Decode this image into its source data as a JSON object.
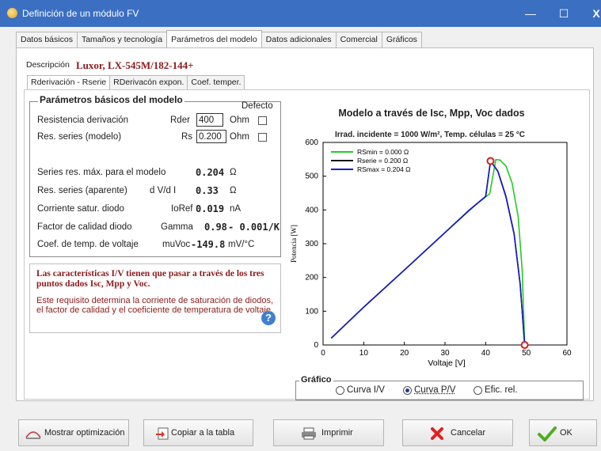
{
  "window": {
    "title": "Definición de un módulo FV",
    "minimize": "—",
    "maximize": "☐",
    "close": "X"
  },
  "tabs": [
    "Datos básicos",
    "Tamaños y tecnología",
    "Parámetros del modelo",
    "Datos adicionales",
    "Comercial",
    "Gráficos"
  ],
  "active_tab": "Parámetros del modelo",
  "description": {
    "label": "Descripción",
    "value": "Luxor,  LX-545M/182-144+"
  },
  "subtabs": [
    "Rderivación - Rserie",
    "RDerivacón expon.",
    "Coef. temper."
  ],
  "params": {
    "group_title": "Parámetros básicos del modelo",
    "defecto": "Defecto",
    "rder": {
      "label": "Resistencia derivación",
      "symbol": "Rder",
      "value": "400",
      "unit": "Ohm"
    },
    "rs": {
      "label": "Res. series (modelo)",
      "symbol": "Rs",
      "value": "0.200",
      "unit": "Ohm"
    },
    "series_max": {
      "label": "Series res. máx. para el modelo",
      "value": "0.204",
      "unit": "Ω"
    },
    "series_apparent": {
      "label": "Res. series (aparente)",
      "symbol": "d V/d I",
      "value": "0.33",
      "unit": "Ω"
    },
    "io": {
      "label": "Corriente satur. diodo",
      "symbol": "IoRef",
      "value": "0.019",
      "unit": "nA"
    },
    "gamma": {
      "label": "Factor de calidad diodo",
      "symbol": "Gamma",
      "value": "0.98",
      "value2": "- 0.001/K"
    },
    "muvoc": {
      "label": "Coef. de temp. de voltaje",
      "symbol": "muVoc",
      "value": "-149.8",
      "unit": "mV/°C"
    }
  },
  "note": {
    "title": "Las características I/V tienen que pasar a través de los tres puntos dados Isc, Mpp y Voc.",
    "body": "Este requisito determina la corriente de saturación de diodos, el factor de calidad y el coeficiente de temperatura de voltaje.",
    "help_icon": "?"
  },
  "chart_header": {
    "title": "Modelo a través de Isc, Mpp, Voc dados",
    "subtitle": "Irrad. incidente = 1000 W/m², Temp. células = 25 °C"
  },
  "chart_data": {
    "type": "line",
    "xlabel": "Voltaje [V]",
    "ylabel": "Potencia [W]",
    "xlim": [
      0,
      60
    ],
    "ylim": [
      0,
      600
    ],
    "xticks": [
      0,
      10,
      20,
      30,
      40,
      50,
      60
    ],
    "yticks": [
      0,
      100,
      200,
      300,
      400,
      500,
      600
    ],
    "legend_position": "top-left",
    "series": [
      {
        "name": "RSmin = 0.000 Ω",
        "color": "#22cc22",
        "x": [
          2,
          10,
          20,
          30,
          38,
          41,
          42.5,
          43.5,
          45,
          46.5,
          48,
          49,
          49.6
        ],
        "y": [
          20,
          112,
          222,
          333,
          420,
          448,
          549,
          548,
          530,
          480,
          380,
          220,
          0
        ]
      },
      {
        "name": "Rserie = 0.200 Ω",
        "color": "#111111",
        "x": [
          2,
          10,
          20,
          30,
          36,
          40,
          41.2,
          43,
          45,
          47,
          48.5,
          49.6
        ],
        "y": [
          20,
          112,
          222,
          333,
          400,
          440,
          545,
          515,
          440,
          330,
          180,
          0
        ]
      },
      {
        "name": "RSmax = 0.204 Ω",
        "color": "#1a1acc",
        "x": [
          2,
          10,
          20,
          30,
          36,
          40,
          41.2,
          43,
          45,
          47,
          48.5,
          49.6
        ],
        "y": [
          20,
          112,
          222,
          333,
          400,
          440,
          545,
          514,
          438,
          328,
          178,
          0
        ]
      }
    ],
    "markers": [
      {
        "x": 41.2,
        "y": 545
      },
      {
        "x": 49.6,
        "y": 0
      }
    ]
  },
  "grafico": {
    "title": "Gráfico",
    "options": [
      {
        "label": "Curva I/V",
        "selected": false
      },
      {
        "label": "Curva P/V",
        "selected": true
      },
      {
        "label": "Efic. rel.",
        "selected": false
      }
    ]
  },
  "buttons": {
    "optim": "Mostrar optimización",
    "copy": "Copiar a la tabla",
    "print": "Imprimir",
    "cancel": "Cancelar",
    "ok": "OK"
  }
}
